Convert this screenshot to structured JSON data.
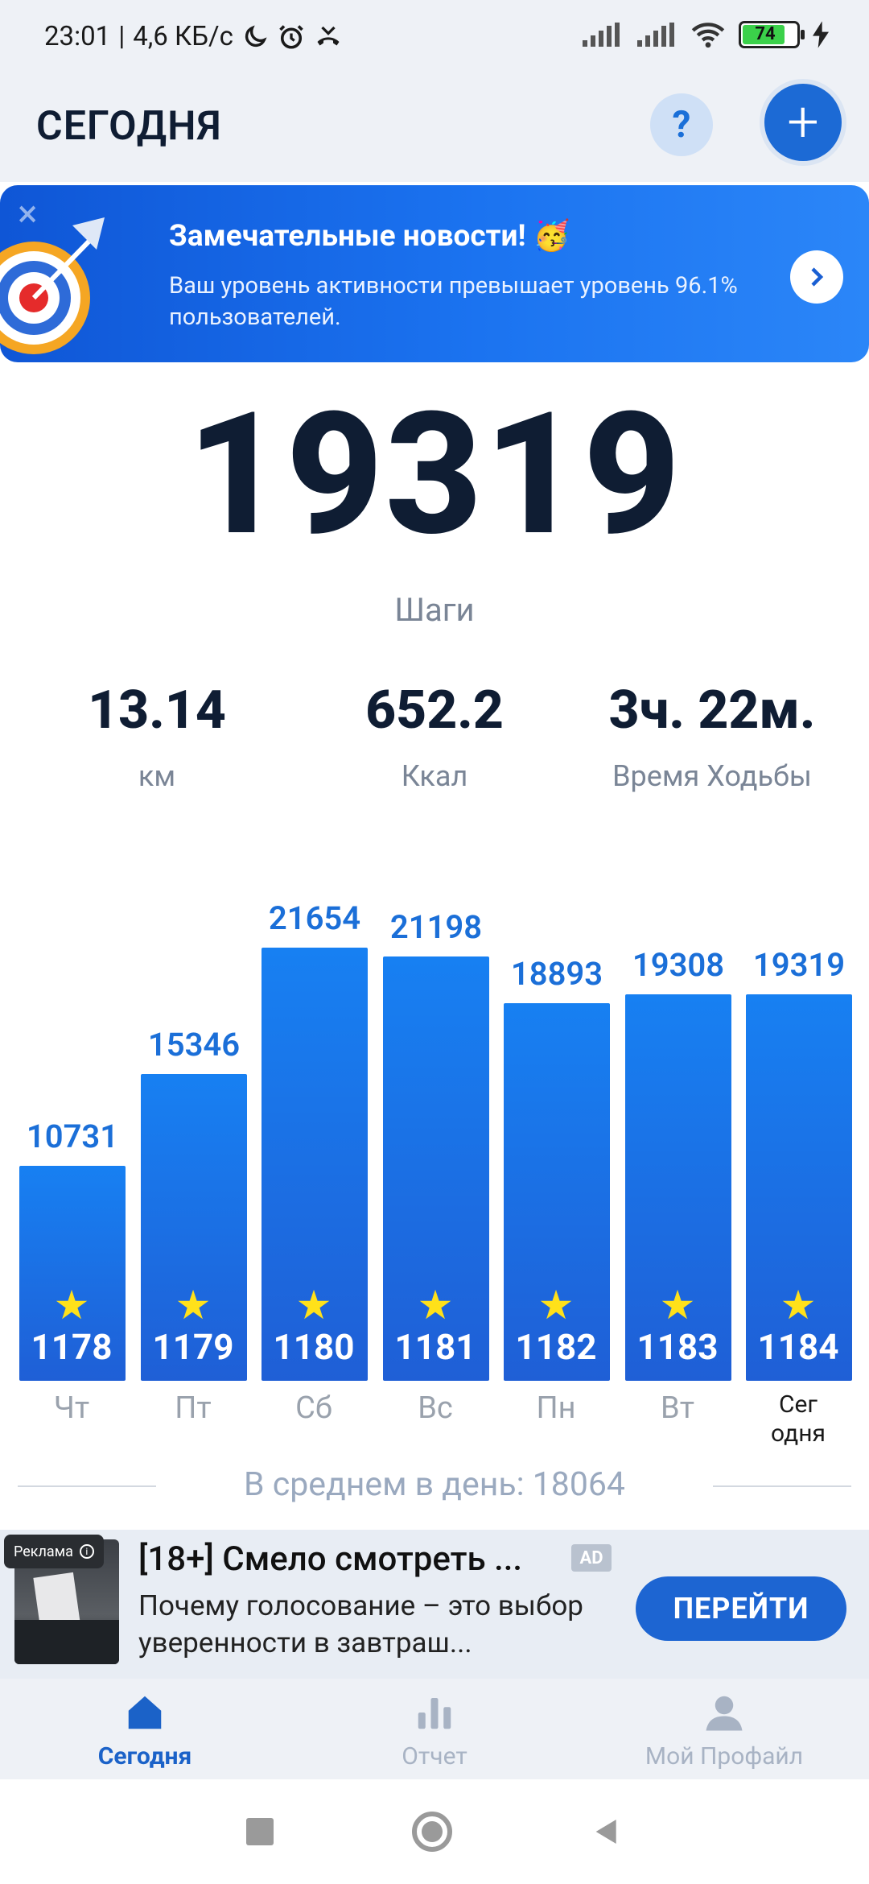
{
  "status_bar": {
    "time": "23:01",
    "network_speed": "4,6 КБ/с",
    "battery": "74",
    "icons": [
      "moon-icon",
      "alarm-icon",
      "missed-call-icon",
      "signal-icon",
      "signal-icon",
      "wifi-icon",
      "battery-icon",
      "charging-icon"
    ]
  },
  "header": {
    "title": "СЕГОДНЯ",
    "help_label": "?",
    "add_label": "+"
  },
  "banner": {
    "close_label": "×",
    "title": "Замечательные новости! 🥳",
    "text": "Ваш уровень активности превышает уровень 96.1% пользователей."
  },
  "summary": {
    "steps": "19319",
    "steps_label": "Шаги",
    "distance": "13.14",
    "distance_label": "км",
    "calories": "652.2",
    "calories_label": "Ккал",
    "time": "3ч. 22м.",
    "time_label": "Время Ходьбы"
  },
  "chart_data": {
    "type": "bar",
    "categories": [
      "Чт",
      "Пт",
      "Сб",
      "Вс",
      "Пн",
      "Вт",
      "Сег одня"
    ],
    "values": [
      10731,
      15346,
      21654,
      21198,
      18893,
      19308,
      19319
    ],
    "day_numbers": [
      "1178",
      "1179",
      "1180",
      "1181",
      "1182",
      "1183",
      "1184"
    ],
    "value_labels": [
      "10731",
      "15346",
      "21654",
      "21198",
      "18893",
      "19308",
      "19319"
    ],
    "today_label_lines": [
      "Сег",
      "одня"
    ],
    "bar_color": "#1a72e8",
    "star_color": "#ffe11a"
  },
  "average": {
    "text": "В среднем в день: 18064"
  },
  "ad": {
    "tag": "Реклама",
    "title": "[18+] Смело смотреть ...",
    "badge": "AD",
    "text": "Почему голосование – это выбор уверенности в завтраш...",
    "button": "ПЕРЕЙТИ"
  },
  "bottom_nav": {
    "items": [
      {
        "label": "Сегодня",
        "icon": "home-icon",
        "active": true
      },
      {
        "label": "Отчет",
        "icon": "bar-chart-icon",
        "active": false
      },
      {
        "label": "Мой Профайл",
        "icon": "profile-icon",
        "active": false
      }
    ]
  }
}
